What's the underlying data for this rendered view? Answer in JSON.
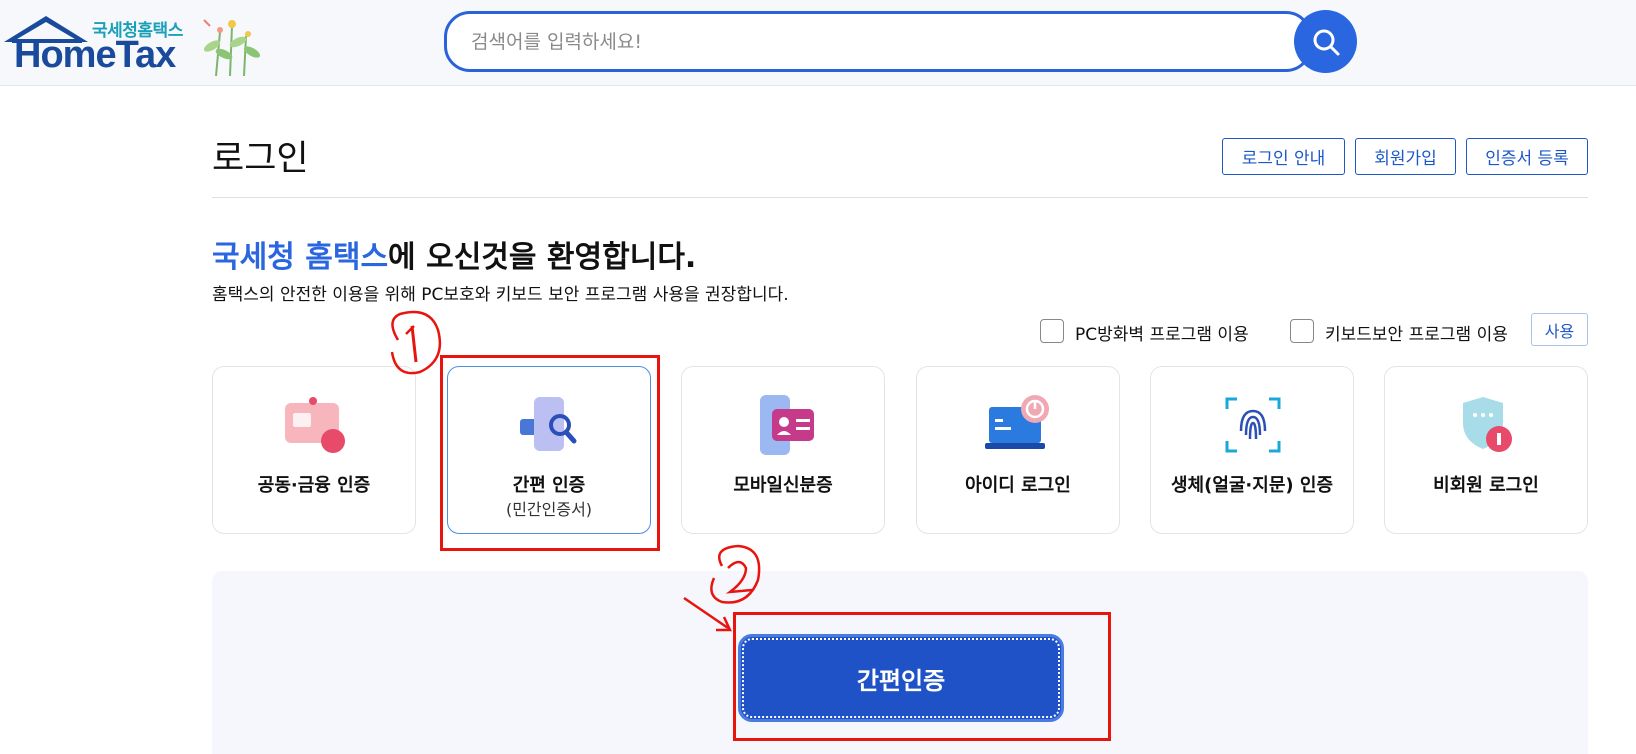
{
  "header": {
    "logo_small": "국세청홈택스",
    "logo_big": "HomeTax",
    "search_placeholder": "검색어를 입력하세요!"
  },
  "page": {
    "title": "로그인",
    "top_buttons": [
      "로그인 안내",
      "회원가입",
      "인증서 등록"
    ],
    "welcome_accent": "국세청 홈택스",
    "welcome_rest": "에 오신것을 환영합니다.",
    "subtext": "홈택스의 안전한 이용을 위해 PC보호와 키보드 보안 프로그램 사용을 권장합니다.",
    "option_firewall": "PC방화벽 프로그램 이용",
    "option_keyboard": "키보드보안 프로그램 이용",
    "use_button": "사용"
  },
  "cards": [
    {
      "label": "공동·금융 인증",
      "sub": "",
      "icon": "certificate-card-icon"
    },
    {
      "label": "간편 인증",
      "sub": "(민간인증서)",
      "icon": "simple-auth-phone-icon"
    },
    {
      "label": "모바일신분증",
      "sub": "",
      "icon": "mobile-id-icon"
    },
    {
      "label": "아이디 로그인",
      "sub": "",
      "icon": "laptop-power-icon"
    },
    {
      "label": "생체(얼굴·지문) 인증",
      "sub": "",
      "icon": "fingerprint-icon"
    },
    {
      "label": "비회원 로그인",
      "sub": "",
      "icon": "shield-guest-icon"
    }
  ],
  "main_button": "간편인증",
  "colors": {
    "accent": "#2a66e0",
    "button": "#1e52c6",
    "annotation": "#e8140e"
  }
}
